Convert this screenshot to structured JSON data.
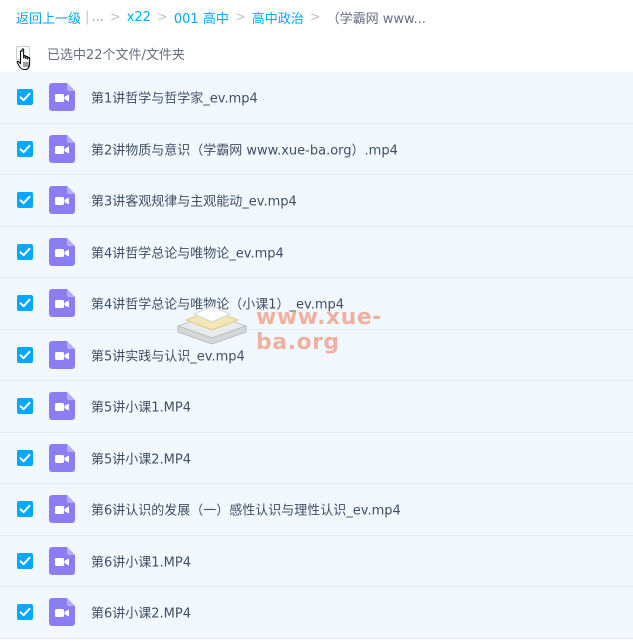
{
  "breadcrumb": {
    "back": "返回上一级",
    "sep_bar": "|",
    "ellipsis": "...",
    "items": [
      "x22",
      "001 高中",
      "高中政治",
      "（学霸网 www..."
    ]
  },
  "selection": {
    "label": "已选中22个文件/文件夹"
  },
  "files": [
    {
      "name": "第1讲哲学与哲学家_ev.mp4"
    },
    {
      "name": "第2讲物质与意识（学霸网 www.xue-ba.org）.mp4"
    },
    {
      "name": "第3讲客观规律与主观能动_ev.mp4"
    },
    {
      "name": "第4讲哲学总论与唯物论_ev.mp4"
    },
    {
      "name": "第4讲哲学总论与唯物论（小课1）_ev.mp4"
    },
    {
      "name": "第5讲实践与认识_ev.mp4"
    },
    {
      "name": "第5讲小课1.MP4"
    },
    {
      "name": "第5讲小课2.MP4"
    },
    {
      "name": "第6讲认识的发展（一）感性认识与理性认识_ev.mp4"
    },
    {
      "name": "第6讲小课1.MP4"
    },
    {
      "name": "第6讲小课2.MP4"
    }
  ],
  "watermark": {
    "text": "www.xue-ba.org"
  },
  "icons": {
    "checkbox": "check-icon",
    "file": "video-file-icon",
    "cursor": "hand-cursor-icon"
  },
  "colors": {
    "accent": "#06a7ff",
    "row_bg": "#f1f8fe",
    "file_icon": "#8a7ef2",
    "watermark": "#f08a6c"
  }
}
